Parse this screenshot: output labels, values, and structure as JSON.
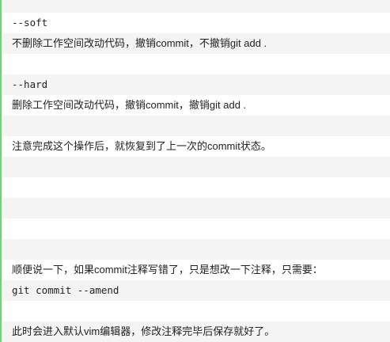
{
  "lines": [
    "",
    "--soft",
    "不删除工作空间改动代码，撤销commit，不撤销git add .",
    "",
    "--hard",
    "删除工作空间改动代码，撤销commit，撤销git add .",
    "",
    "注意完成这个操作后，就恢复到了上一次的commit状态。",
    "",
    "",
    "",
    "",
    "",
    "顺便说一下，如果commit注释写错了，只是想改一下注释，只需要：",
    "git commit --amend",
    "",
    "此时会进入默认vim编辑器，修改注释完毕后保存就好了。"
  ]
}
